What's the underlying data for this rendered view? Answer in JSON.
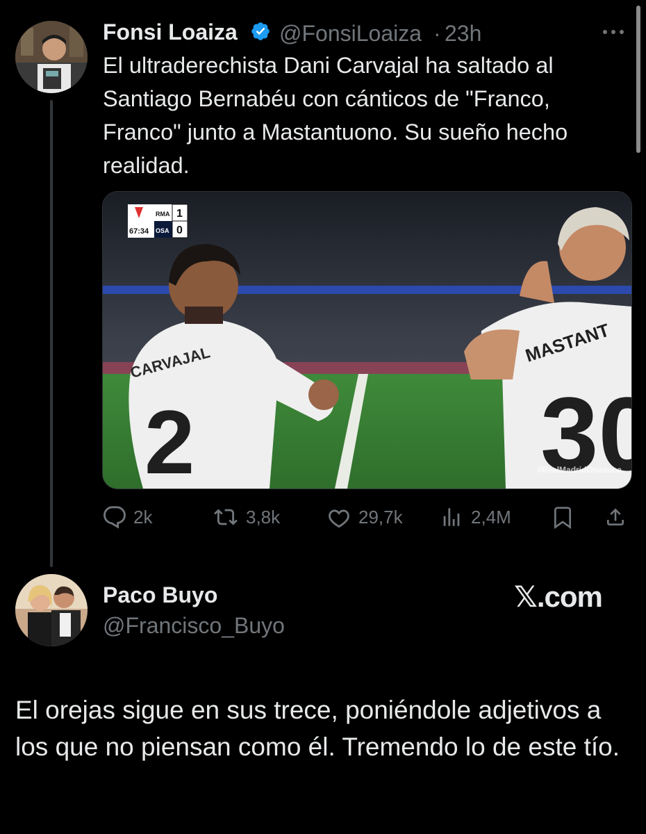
{
  "original_tweet": {
    "author_name": "Fonsi Loaiza",
    "handle": "@FonsiLoaiza",
    "separator": "·",
    "time": "23h",
    "text": "El ultraderechista Dani Carvajal ha saltado al Santiago Bernabéu con cánticos de \"Franco, Franco\" junto a Mastantuono. Su sueño hecho realidad.",
    "media": {
      "scoreboard": {
        "clock": "67:34",
        "home_team": "RMA",
        "home_score": "1",
        "away_team": "OSA",
        "away_score": "0"
      },
      "left_jersey_name": "CARVAJAL",
      "left_jersey_number": "2",
      "right_jersey_name": "MASTANT",
      "right_jersey_number": "30",
      "watermark": "#RealMadridOsasuna"
    },
    "actions": {
      "replies": "2k",
      "reposts": "3,8k",
      "likes": "29,7k",
      "views": "2,4M"
    }
  },
  "reply": {
    "author_name": "Paco Buyo",
    "handle": "@Francisco_Buyo",
    "text": "El orejas sigue en sus trece, poniéndole adjetivos a los que no piensan como él. Tremendo lo de este tío."
  },
  "brand": "𝕏.com",
  "icons": [
    "verified-icon",
    "more-icon",
    "reply-icon",
    "repost-icon",
    "like-icon",
    "views-icon",
    "bookmark-icon",
    "share-icon"
  ],
  "colors": {
    "background": "#000000",
    "text": "#e7e9ea",
    "secondary": "#71767b",
    "verified": "#1d9bf0"
  }
}
